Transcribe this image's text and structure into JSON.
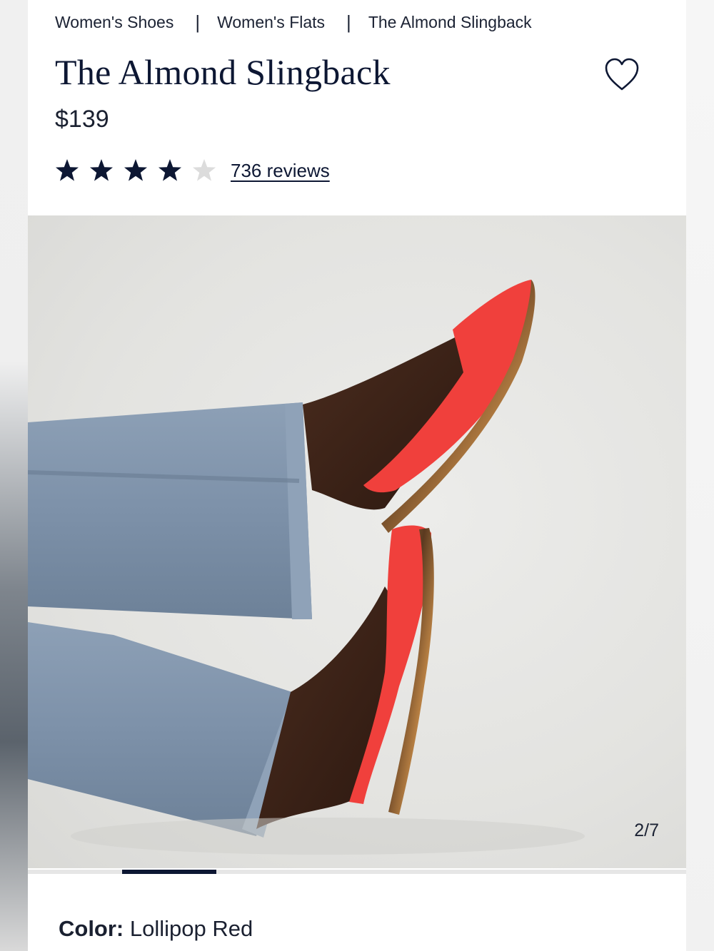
{
  "breadcrumbs": [
    "Women's Shoes",
    "Women's Flats",
    "The Almond Slingback"
  ],
  "breadcrumb_separator": "|",
  "product": {
    "title": "The Almond Slingback",
    "price": "$139",
    "rating": {
      "stars_filled": 4,
      "stars_total": 5,
      "reviews_label": "736 reviews"
    }
  },
  "gallery": {
    "counter": "2/7",
    "progress_fraction": 0.143
  },
  "color": {
    "label": "Color:",
    "value": "Lollipop Red"
  },
  "colors": {
    "navy": "#0d1733",
    "star_empty": "#dcdcdc",
    "shoe_red": "#f0403c"
  }
}
